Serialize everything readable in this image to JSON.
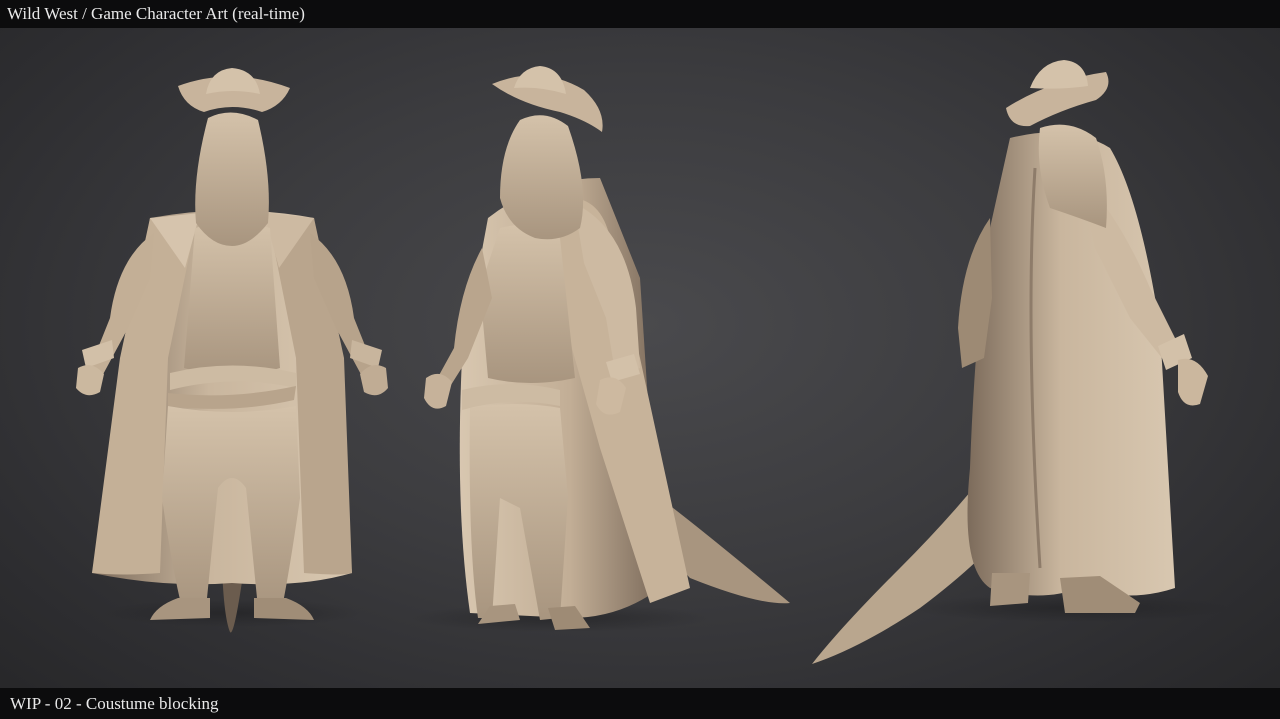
{
  "header": {
    "title": "Wild West / Game Character Art (real-time)"
  },
  "footer": {
    "caption": "WIP - 02 - Coustume blocking"
  },
  "render": {
    "views": [
      "front",
      "three-quarter",
      "back-three-quarter"
    ],
    "subject": "sculpted lizard cowboy character in long coat and hat",
    "colors": {
      "clay": "#c8b49c",
      "clay_shadow": "#8a7866",
      "clay_dark": "#5c4f43",
      "background": "#3c3c3f",
      "bars": "#0c0c0d"
    }
  }
}
